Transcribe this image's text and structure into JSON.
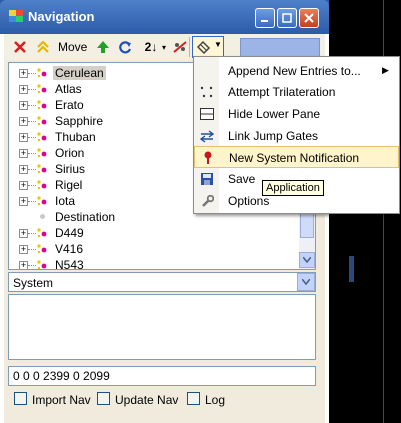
{
  "window": {
    "title": "Navigation"
  },
  "toolbar": {
    "move_label": "Move",
    "sort_label": "2↓"
  },
  "tree": {
    "items": [
      {
        "label": "Cerulean",
        "kind": "system",
        "selected": true
      },
      {
        "label": "Atlas",
        "kind": "system"
      },
      {
        "label": "Erato",
        "kind": "system"
      },
      {
        "label": "Sapphire",
        "kind": "system"
      },
      {
        "label": "Thuban",
        "kind": "system"
      },
      {
        "label": "Orion",
        "kind": "system"
      },
      {
        "label": "Sirius",
        "kind": "system"
      },
      {
        "label": "Rigel",
        "kind": "system"
      },
      {
        "label": "Iota",
        "kind": "system"
      },
      {
        "label": "Destination",
        "kind": "point"
      },
      {
        "label": "D449",
        "kind": "system"
      },
      {
        "label": "V416",
        "kind": "system"
      },
      {
        "label": "N543",
        "kind": "system"
      }
    ]
  },
  "system_combo": {
    "value": "System"
  },
  "coords": {
    "value": "0 0 0 2399 0 2099"
  },
  "checkboxes": {
    "import_nav": "Import Nav",
    "update_nav": "Update Nav",
    "log": "Log"
  },
  "menu": {
    "append": "Append New Entries to...",
    "trilateration": "Attempt Trilateration",
    "hide_lower": "Hide Lower Pane",
    "link_jump": "Link Jump Gates",
    "new_notification": "New System Notification",
    "save": "Save",
    "options": "Options"
  },
  "tooltip": {
    "text": "Application"
  },
  "colors": {
    "titlebar": "#2c5ba8",
    "menu_highlight": "#fff4cc",
    "selection": "#d4d0c8"
  }
}
